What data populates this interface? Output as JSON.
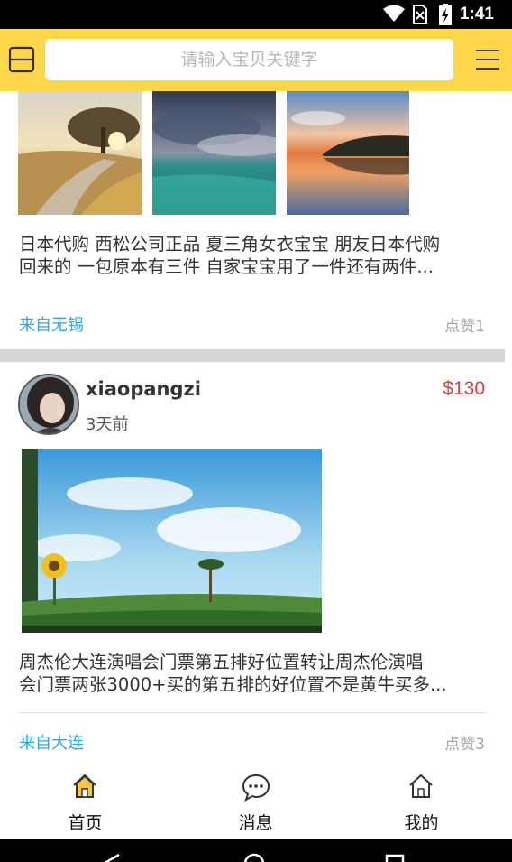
{
  "status_bar": {
    "time": "1:41",
    "icons": [
      "wifi-icon",
      "no-sim-icon",
      "battery-charging-icon"
    ]
  },
  "header": {
    "search_placeholder": "请输入宝贝关键字",
    "left_icon": "scan-icon",
    "right_icon": "menu-icon",
    "background_color": "#fdd64a"
  },
  "posts": [
    {
      "images": [
        "sunset-path",
        "teal-sea-clouds",
        "lake-reflection"
      ],
      "description_lines": [
        "日本代购 西松公司正品 夏三角女衣宝宝 朋友日本代购",
        "回来的 一包原本有三件 自家宝宝用了一件还有两件..."
      ],
      "from": "来自无锡",
      "likes": "点赞1"
    },
    {
      "username": "xiaopangzi",
      "time_ago": "3天前",
      "price": "$130",
      "images": [
        "sunflower-meadow"
      ],
      "description_lines": [
        "周杰伦大连演唱会门票第五排好位置转让周杰伦演唱",
        "会门票两张3000+买的第五排的好位置不是黄牛买多..."
      ],
      "from": "来自大连",
      "likes": "点赞3"
    }
  ],
  "bottom_nav": [
    {
      "label": "首页",
      "icon": "home-icon",
      "active": true
    },
    {
      "label": "消息",
      "icon": "message-icon",
      "active": false
    },
    {
      "label": "我的",
      "icon": "profile-home-icon",
      "active": false
    }
  ],
  "colors": {
    "accent": "#fdd64a",
    "link": "#2ea6df",
    "price": "#e33d3d",
    "muted": "#a5a5a5"
  }
}
